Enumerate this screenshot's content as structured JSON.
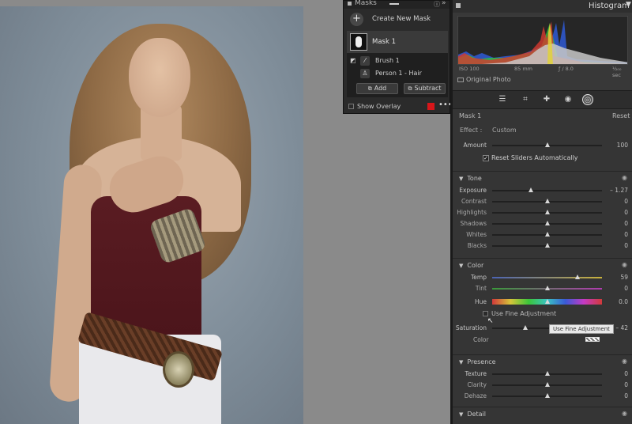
{
  "masks_panel": {
    "title": "Masks",
    "create_label": "Create New Mask",
    "mask_name": "Mask 1",
    "components": [
      {
        "label": "Brush 1",
        "icon": "brush-icon"
      },
      {
        "label": "Person 1 - Hair",
        "icon": "person-icon"
      }
    ],
    "add_label": "Add",
    "subtract_label": "Subtract",
    "show_overlay_label": "Show Overlay",
    "overlay_color": "#d8161a"
  },
  "histogram": {
    "title": "Histogram",
    "iso": "ISO 100",
    "focal": "85 mm",
    "aperture": "ƒ / 8.0",
    "shutter": "¹⁄₂₀₀ sec",
    "original_label": "Original Photo"
  },
  "tool_icons": [
    "sliders-icon",
    "crop-icon",
    "heal-icon",
    "redeye-icon",
    "masking-icon"
  ],
  "mask_settings": {
    "name": "Mask 1",
    "reset": "Reset",
    "effect_label": "Effect :",
    "effect_value": "Custom",
    "amount_label": "Amount",
    "amount_value": "100",
    "amount_pos": 0.5,
    "auto_reset_label": "Reset Sliders Automatically",
    "auto_reset_checked": "✓"
  },
  "tone": {
    "title": "Tone",
    "sliders": [
      {
        "label": "Exposure",
        "value": "– 1.27",
        "pos": 0.35
      },
      {
        "label": "Contrast",
        "value": "0",
        "pos": 0.5
      },
      {
        "label": "Highlights",
        "value": "0",
        "pos": 0.5
      },
      {
        "label": "Shadows",
        "value": "0",
        "pos": 0.5
      },
      {
        "label": "Whites",
        "value": "0",
        "pos": 0.5
      },
      {
        "label": "Blacks",
        "value": "0",
        "pos": 0.5
      }
    ]
  },
  "color": {
    "title": "Color",
    "temp": {
      "label": "Temp",
      "value": "59",
      "pos": 0.78
    },
    "tint": {
      "label": "Tint",
      "value": "0",
      "pos": 0.5
    },
    "hue": {
      "label": "Hue",
      "value": "0.0",
      "pos": 0.5
    },
    "fine_label": "Use Fine Adjustment",
    "saturation": {
      "label": "Saturation",
      "value": "– 42",
      "pos": 0.3
    },
    "tooltip": "Use Fine Adjustment",
    "color_label": "Color"
  },
  "presence": {
    "title": "Presence",
    "sliders": [
      {
        "label": "Texture",
        "value": "0",
        "pos": 0.5
      },
      {
        "label": "Clarity",
        "value": "0",
        "pos": 0.5
      },
      {
        "label": "Dehaze",
        "value": "0",
        "pos": 0.5
      }
    ]
  },
  "detail": {
    "title": "Detail"
  }
}
